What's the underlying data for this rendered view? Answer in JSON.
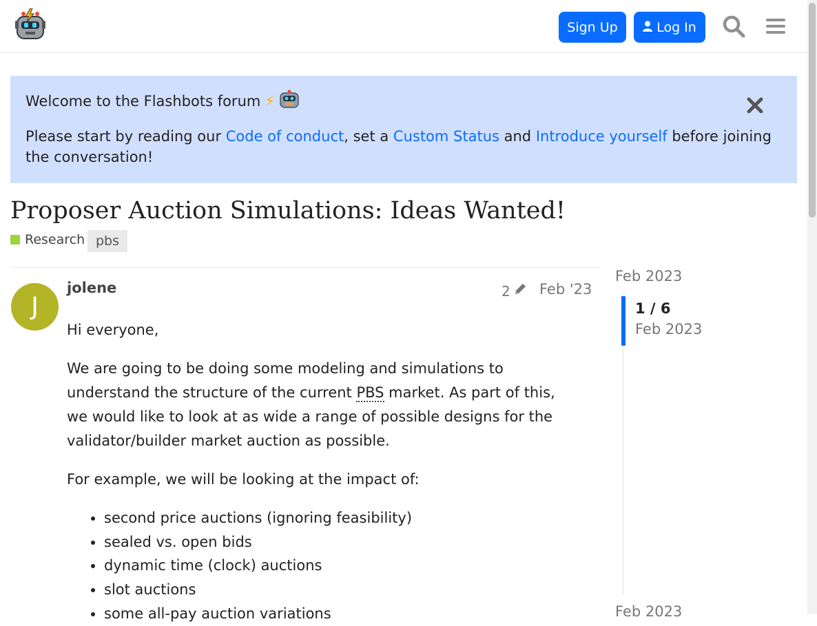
{
  "header": {
    "logo_icon": "flashbots-robot-logo-icon",
    "signup_label": "Sign Up",
    "login_label": "Log In",
    "login_icon": "user-icon",
    "search_icon": "search-icon",
    "menu_icon": "hamburger-menu-icon",
    "accent_color": "#0a6cff"
  },
  "banner": {
    "title": "Welcome to the Flashbots forum",
    "emojis": [
      "⚡",
      "robot-face-icon"
    ],
    "text_before": "Please start by reading our ",
    "link_conduct": "Code of conduct",
    "text_mid1": ", set a ",
    "link_status": "Custom Status",
    "text_mid2": " and ",
    "link_introduce": "Introduce yourself",
    "text_after": " before joining the conversation!",
    "close_icon": "close-icon",
    "background_color": "#d1dfff"
  },
  "topic": {
    "title": "Proposer Auction Simulations: Ideas Wanted!",
    "category": "Research",
    "category_color": "#9fd23e",
    "tag": "pbs"
  },
  "post": {
    "avatar_letter": "J",
    "avatar_color": "#b3b527",
    "username": "jolene",
    "edit_count": "2",
    "edit_icon": "pencil-icon",
    "date": "Feb '23",
    "greeting": "Hi everyone,",
    "para1_before": "We are going to be doing some modeling and simulations to understand the structure of the current ",
    "para1_abbr": "PBS",
    "para1_after": " market. As part of this, we would like to look at as wide a range of possible designs for the validator/builder market auction as possible.",
    "para2": "For example, we will be looking at the impact of:",
    "list": [
      "second price auctions (ignoring feasibility)",
      "sealed vs. open bids",
      "dynamic time (clock) auctions",
      "slot auctions",
      "some all-pay auction variations"
    ]
  },
  "timeline": {
    "start_date": "Feb 2023",
    "position": "1 / 6",
    "current_date": "Feb 2023",
    "end_date": "Feb 2023"
  }
}
